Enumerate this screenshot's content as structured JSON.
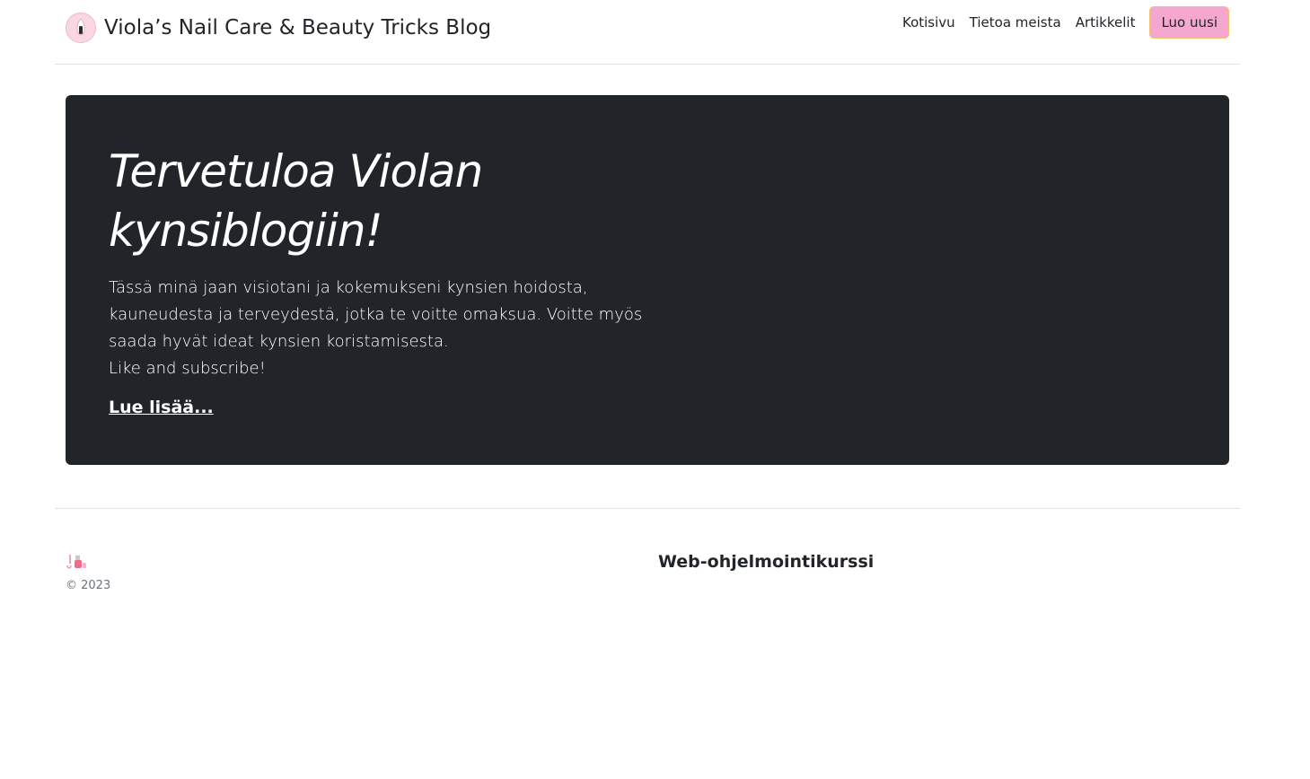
{
  "header": {
    "brand_title": "Viola’s Nail Care & Beauty Tricks Blog",
    "brand_logo_icon": "nail-polish-logo-icon",
    "nav": {
      "home": "Kotisivu",
      "about": "Tietoa meista",
      "articles": "Artikkelit",
      "create_button": "Luo uusi"
    }
  },
  "hero": {
    "title": "Tervetuloa Violan kynsiblogiin!",
    "paragraph_line1": "Tässä minä jaan visiotani ja kokemukseni kynsien hoidosta, kauneudesta ja terveydestä, jotka te voitte omaksua. Voitte myös saada hyvät ideat kynsien koristamisesta.",
    "paragraph_line2": "Like and subscribe!",
    "read_more": "Lue lisää..."
  },
  "footer": {
    "icon": "nail-polish-icon",
    "copyright": "© 2023",
    "heading": "Web-ohjelmointikurssi"
  },
  "colors": {
    "hero_background": "#212529",
    "button_background": "#f4a7cf",
    "button_border": "#f2c36b",
    "divider": "#dee2e6"
  }
}
